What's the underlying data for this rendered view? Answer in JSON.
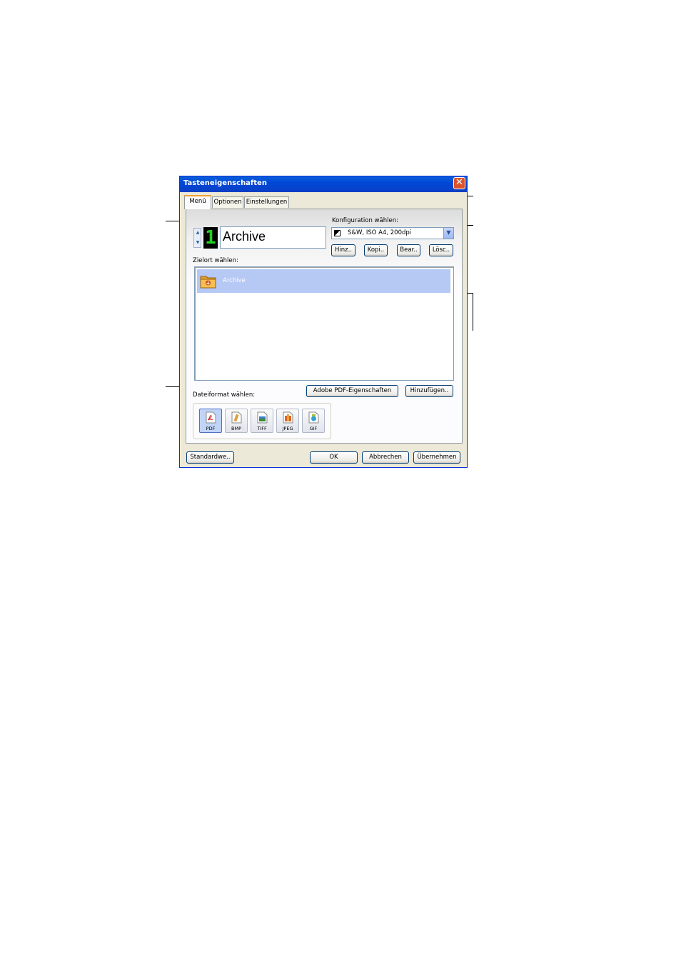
{
  "dialog": {
    "title": "Tasteneigenschaften",
    "close_glyph": "✕"
  },
  "tabs": [
    {
      "label": "Menü",
      "active": true
    },
    {
      "label": "Optionen",
      "active": false
    },
    {
      "label": "Einstellungen",
      "active": false
    }
  ],
  "menu": {
    "button_number": "1",
    "button_name": "Archive",
    "config_label": "Konfiguration wählen:",
    "config_value": "S&W, ISO A4, 200dpi",
    "config_buttons": [
      "Hinz..",
      "Kopi..",
      "Bear..",
      "Lösc.."
    ],
    "destination_label": "Zielort wählen:",
    "destinations": [
      {
        "name": "Archive",
        "icon": "folder-icon",
        "selected": true
      }
    ],
    "pdf_properties_button": "Adobe PDF-Eigenschaften",
    "add_button": "Hinzufügen..",
    "format_label": "Dateiformat wählen:",
    "formats": [
      {
        "label": "PDF",
        "selected": true,
        "icon": "pdf-icon"
      },
      {
        "label": "BMP",
        "selected": false,
        "icon": "bmp-icon"
      },
      {
        "label": "TIFF",
        "selected": false,
        "icon": "tiff-icon"
      },
      {
        "label": "JPEG",
        "selected": false,
        "icon": "jpeg-icon"
      },
      {
        "label": "GIF",
        "selected": false,
        "icon": "gif-icon"
      }
    ]
  },
  "footer": {
    "defaults_button": "Standardwe..",
    "ok_button": "OK",
    "cancel_button": "Abbrechen",
    "apply_button": "Übernehmen"
  },
  "colors": {
    "titlebar": "#0054e3",
    "selection": "#b6c8f4",
    "led_digit": "#20d020",
    "close_button": "#d9532c"
  }
}
